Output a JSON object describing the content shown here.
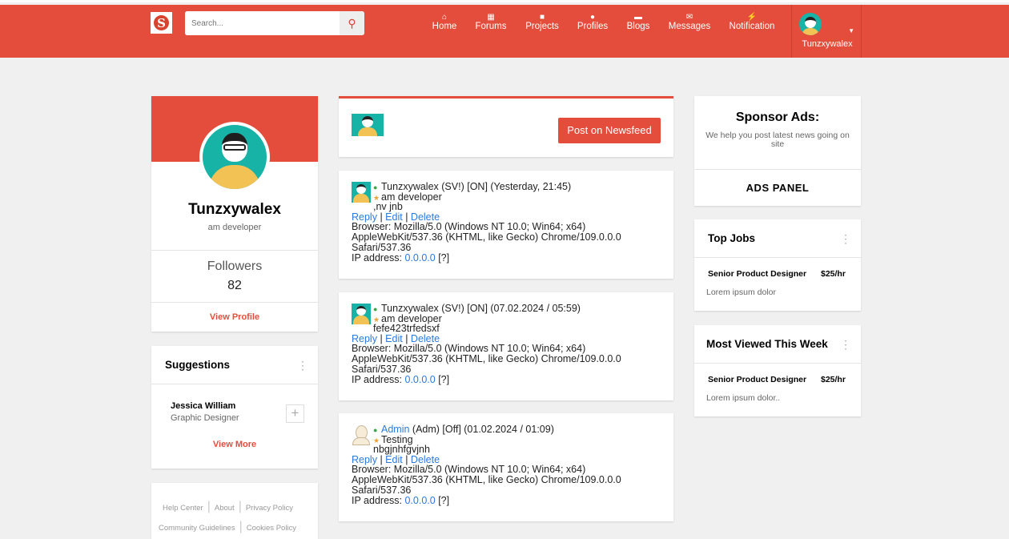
{
  "header": {
    "logo": "S",
    "search_placeholder": "Search...",
    "nav": [
      {
        "label": "Home",
        "icon": "home-icon",
        "glyph": "⌂"
      },
      {
        "label": "Forums",
        "icon": "building-icon",
        "glyph": "▦"
      },
      {
        "label": "Projects",
        "icon": "puzzle-icon",
        "glyph": "■"
      },
      {
        "label": "Profiles",
        "icon": "user-icon",
        "glyph": "●"
      },
      {
        "label": "Blogs",
        "icon": "briefcase-icon",
        "glyph": "▬"
      },
      {
        "label": "Messages",
        "icon": "envelope-icon",
        "glyph": "✉"
      },
      {
        "label": "Notification",
        "icon": "bolt-icon",
        "glyph": "⚡"
      }
    ],
    "user": "Tunzxywalex"
  },
  "colors": {
    "brand": "#e44d3b",
    "link": "#2a7ae2"
  },
  "profile": {
    "name": "Tunzxywalex",
    "tagline": "am developer",
    "followers_label": "Followers",
    "followers": "82",
    "view_profile": "View Profile"
  },
  "suggestions": {
    "title": "Suggestions",
    "items": [
      {
        "name": "Jessica William",
        "role": "Graphic Designer"
      }
    ],
    "view_more": "View More"
  },
  "footer_links": [
    "Help Center",
    "About",
    "Privacy Policy",
    "Community Guidelines",
    "Cookies Policy"
  ],
  "composer": {
    "button": "Post on Newsfeed"
  },
  "posts": [
    {
      "author": "Tunzxywalex",
      "meta": " (SV!) [ON] (Yesterday, 21:45)",
      "status": "am developer",
      "body": ",nv jnb",
      "avatar": "dev",
      "author_link": false
    },
    {
      "author": "Tunzxywalex",
      "meta": " (SV!) [ON] (07.02.2024 / 05:59)",
      "status": "am developer",
      "body": "fefe423trfedsxf",
      "avatar": "dev",
      "author_link": false
    },
    {
      "author": "Admin",
      "meta": " (Adm) [Off] (01.02.2024 / 01:09)",
      "status": "Testing",
      "body": "nbgjnhfgvjnh",
      "avatar": "default",
      "author_link": true
    }
  ],
  "post_actions": {
    "reply": "Reply",
    "edit": "Edit",
    "delete": "Delete",
    "sep": " | ",
    "browser_label": "Browser: ",
    "browser": "Mozilla/5.0 (Windows NT 10.0; Win64; x64) AppleWebKit/537.36 (KHTML, like Gecko) Chrome/109.0.0.0 Safari/537.36",
    "ip_label": "IP address: ",
    "ip": "0.0.0.0",
    "ip_help": "[?]"
  },
  "sponsor": {
    "title": "Sponsor Ads:",
    "text": "We help you post latest news going on site",
    "panel": "ADS PANEL"
  },
  "top_jobs": {
    "title": "Top Jobs",
    "job": "Senior Product Designer",
    "rate": "$25/hr",
    "desc": "Lorem ipsum dolor"
  },
  "most_viewed": {
    "title": "Most Viewed This Week",
    "job": "Senior Product Designer",
    "rate": "$25/hr",
    "desc": "Lorem ipsum dolor.."
  }
}
